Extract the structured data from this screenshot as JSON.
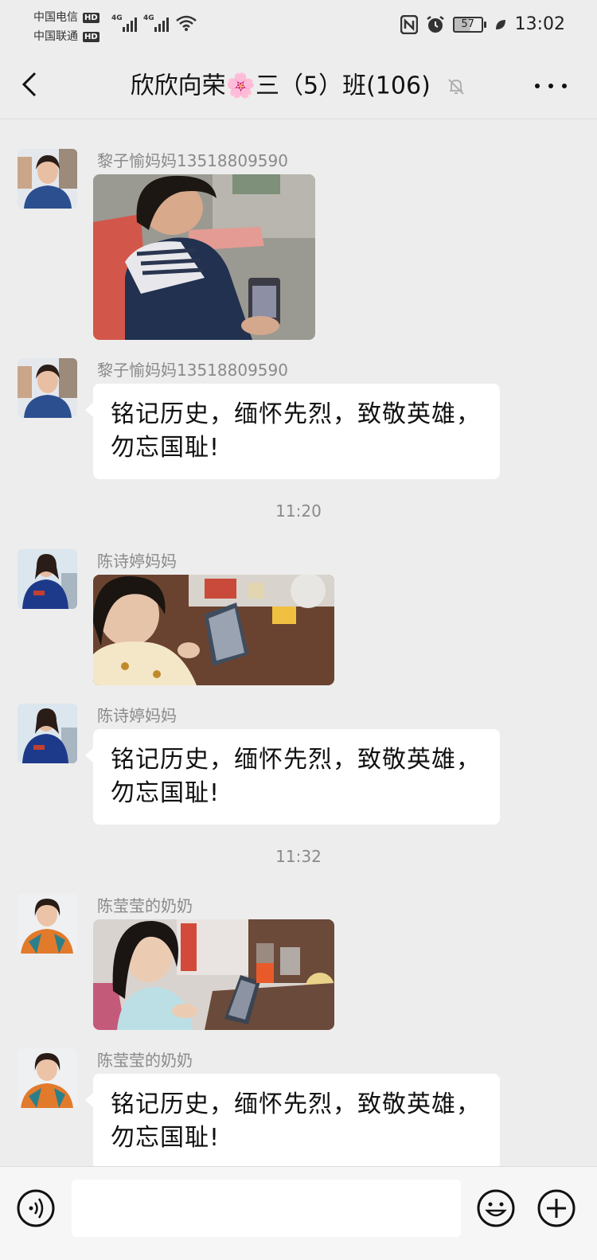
{
  "status_bar": {
    "carrier1": "中国电信",
    "carrier2": "中国联通",
    "hd": "HD",
    "net1": "4G",
    "net2": "4G",
    "battery": "57",
    "time": "13:02"
  },
  "header": {
    "title_part1": "欣欣向荣",
    "title_emoji": "🌸",
    "title_part2": "三（5）班(106)"
  },
  "messages": [
    {
      "sender": "黎子愉妈妈13518809590",
      "type": "image"
    },
    {
      "sender": "黎子愉妈妈13518809590",
      "type": "text",
      "text_line1": "铭记历史，缅怀先烈，致敬英雄，",
      "text_line2": "勿忘国耻!"
    },
    {
      "timestamp": "11:20"
    },
    {
      "sender": "陈诗婷妈妈",
      "type": "image"
    },
    {
      "sender": "陈诗婷妈妈",
      "type": "text",
      "text_line1": "铭记历史，缅怀先烈，致敬英雄，",
      "text_line2": "勿忘国耻!"
    },
    {
      "timestamp": "11:32"
    },
    {
      "sender": "陈莹莹的奶奶",
      "type": "image"
    },
    {
      "sender": "陈莹莹的奶奶",
      "type": "text",
      "text_line1": "铭记历史，缅怀先烈，致敬英雄，",
      "text_line2": "勿忘国耻!"
    }
  ],
  "input": {
    "value": ""
  }
}
